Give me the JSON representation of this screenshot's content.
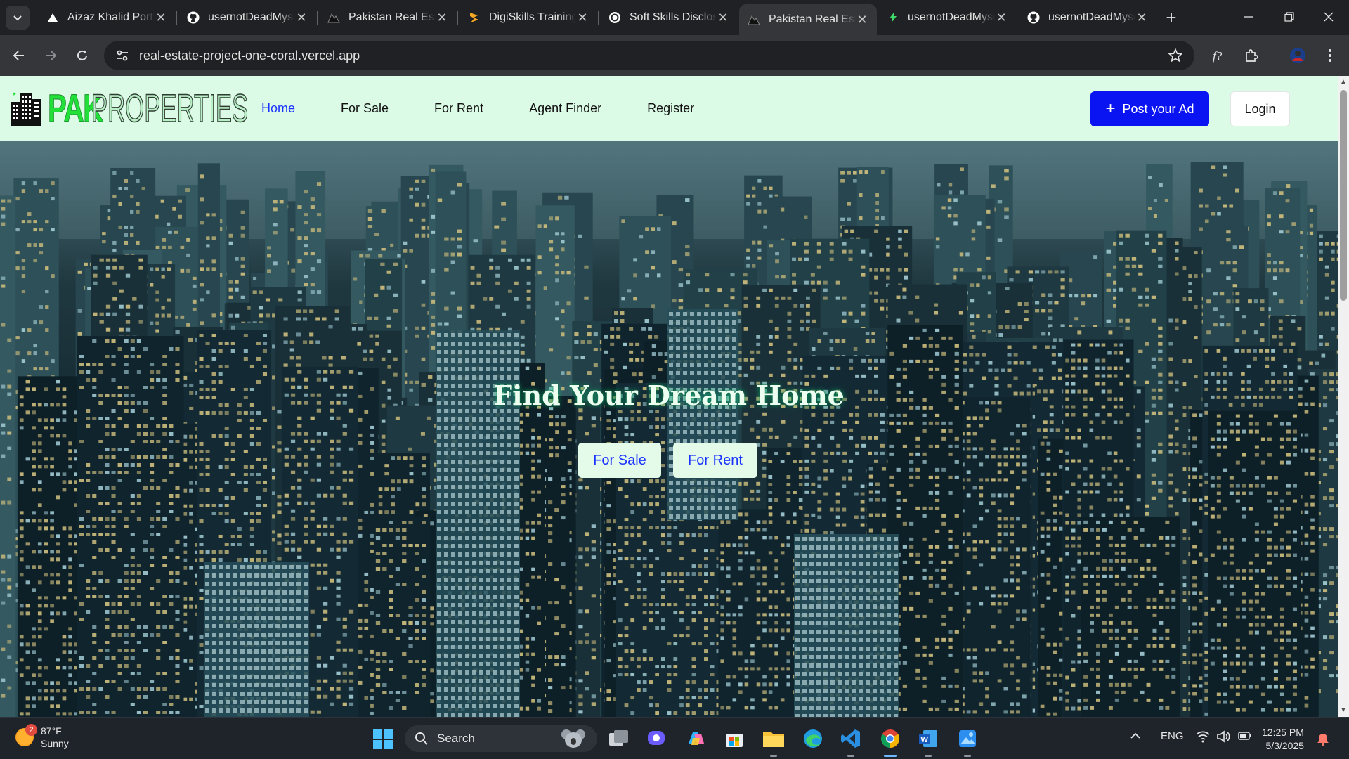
{
  "browser": {
    "tabs": [
      {
        "title": "Aizaz Khalid Portfolio",
        "icon": "vercel-icon",
        "active": false
      },
      {
        "title": "usernotDeadMyself",
        "icon": "github-icon",
        "active": false
      },
      {
        "title": "Pakistan Real Estate",
        "icon": "site-icon",
        "active": false
      },
      {
        "title": "DigiSkills Training",
        "icon": "digiskills-icon",
        "active": false
      },
      {
        "title": "Soft Skills Disclosure",
        "icon": "openai-icon",
        "active": false
      },
      {
        "title": "Pakistan Real Estate",
        "icon": "site-icon",
        "active": true
      },
      {
        "title": "usernotDeadMyself",
        "icon": "lightning-icon",
        "active": false
      },
      {
        "title": "usernotDeadMyself",
        "icon": "github-icon",
        "active": false
      }
    ],
    "url": "real-estate-project-one-coral.vercel.app"
  },
  "site": {
    "nav": {
      "home": "Home",
      "for_sale": "For Sale",
      "for_rent": "For Rent",
      "agent_finder": "Agent Finder",
      "register": "Register"
    },
    "logo": {
      "part1": "PAK",
      "part2": "PROPERTIES"
    },
    "post_ad": "Post your Ad",
    "login": "Login",
    "hero": {
      "title": "Find Your Dream Home",
      "sale_button": "For Sale",
      "rent_button": "For Rent"
    },
    "colors": {
      "nav_bg": "#dcfbe6",
      "accent": "#0a14f2",
      "link_active": "#1a33ff",
      "logo_green": "#22e03a"
    }
  },
  "taskbar": {
    "weather": {
      "temp": "87°F",
      "condition": "Sunny",
      "badge": "2"
    },
    "search_placeholder": "Search",
    "language": "ENG",
    "time": "12:25 PM",
    "date": "5/3/2025"
  }
}
